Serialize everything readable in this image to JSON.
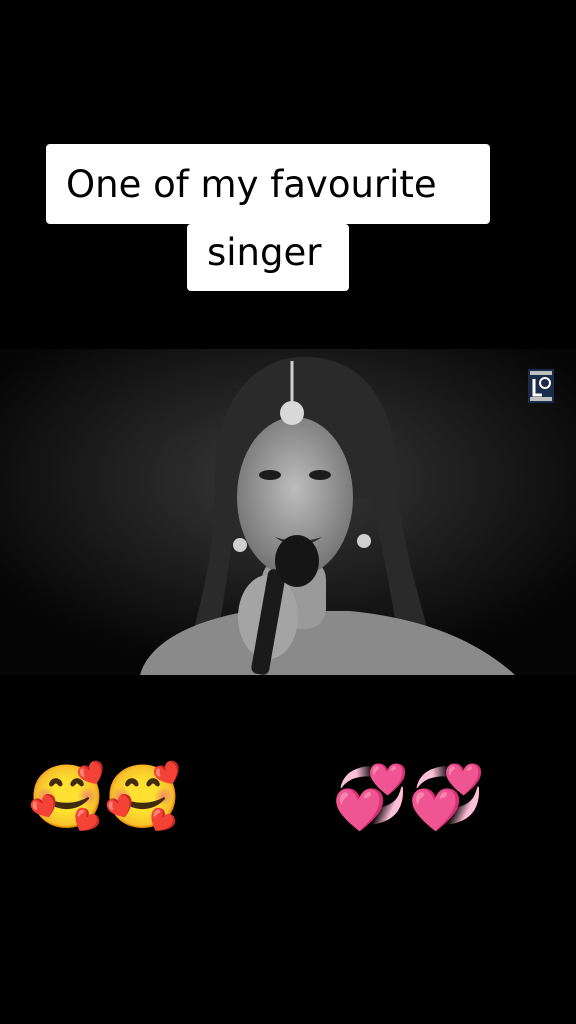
{
  "caption": {
    "line1": "One of my favourite",
    "line2": "singer"
  },
  "video": {
    "content": "singer-photo",
    "channel_logo_icon": "channel-logo-icon"
  },
  "emojis": [
    "🥰",
    "🥰",
    "😍",
    "😍",
    "💞",
    "💞"
  ],
  "colors": {
    "background": "#000000",
    "caption_background": "#ffffff",
    "caption_text": "#000000"
  }
}
